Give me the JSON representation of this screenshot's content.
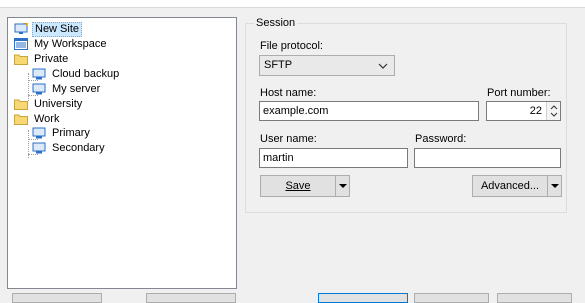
{
  "tree": {
    "items": [
      {
        "label": "New Site",
        "icon": "new-site-icon"
      },
      {
        "label": "My Workspace",
        "icon": "workspace-icon"
      },
      {
        "label": "Private",
        "icon": "folder-icon"
      },
      {
        "label": "Cloud backup",
        "icon": "computer-icon"
      },
      {
        "label": "My server",
        "icon": "computer-icon"
      },
      {
        "label": "University",
        "icon": "folder-icon"
      },
      {
        "label": "Work",
        "icon": "folder-icon"
      },
      {
        "label": "Primary",
        "icon": "computer-icon"
      },
      {
        "label": "Secondary",
        "icon": "computer-icon"
      }
    ]
  },
  "session": {
    "legend": "Session",
    "file_protocol_label": "File protocol:",
    "file_protocol_value": "SFTP",
    "host_name_label": "Host name:",
    "host_name_value": "example.com",
    "port_label": "Port number:",
    "port_value": "22",
    "user_name_label": "User name:",
    "user_name_value": "martin",
    "password_label": "Password:",
    "password_value": "",
    "save_label": "Save",
    "advanced_label": "Advanced..."
  },
  "colors": {
    "selection": "#cce8ff",
    "folder": "#f8d775",
    "computer": "#2b6fc7"
  }
}
